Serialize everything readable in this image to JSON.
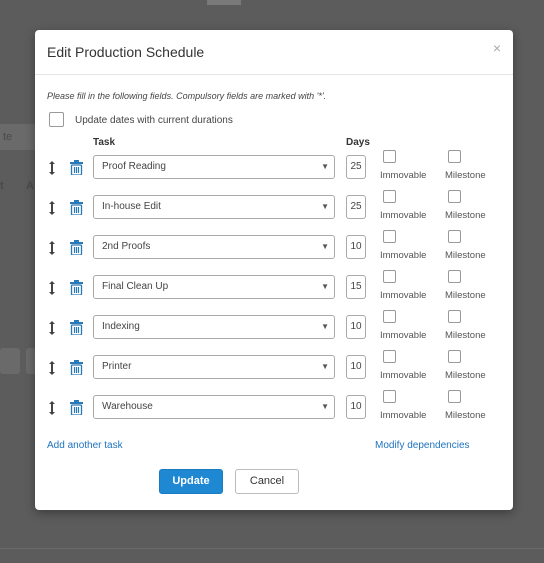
{
  "background": {
    "fragments": [
      "te",
      "t",
      "A"
    ]
  },
  "modal": {
    "title": "Edit Production Schedule",
    "close_icon": "×",
    "instructions": "Please fill in the following fields. Compulsory fields are marked with '*'.",
    "update_dates_label": "Update dates with current durations",
    "headers": {
      "task": "Task",
      "days": "Days"
    },
    "rows": [
      {
        "task": "Proof Reading",
        "days": "25",
        "immovable": "Immovable",
        "milestone": "Milestone"
      },
      {
        "task": "In-house Edit",
        "days": "25",
        "immovable": "Immovable",
        "milestone": "Milestone"
      },
      {
        "task": "2nd Proofs",
        "days": "10",
        "immovable": "Immovable",
        "milestone": "Milestone"
      },
      {
        "task": "Final Clean Up",
        "days": "15",
        "immovable": "Immovable",
        "milestone": "Milestone"
      },
      {
        "task": "Indexing",
        "days": "10",
        "immovable": "Immovable",
        "milestone": "Milestone"
      },
      {
        "task": "Printer",
        "days": "10",
        "immovable": "Immovable",
        "milestone": "Milestone"
      },
      {
        "task": "Warehouse",
        "days": "10",
        "immovable": "Immovable",
        "milestone": "Milestone"
      }
    ],
    "add_task_link": "Add another task",
    "modify_dependencies_link": "Modify dependencies",
    "update_button": "Update",
    "cancel_button": "Cancel"
  },
  "colors": {
    "accent": "#1e88d2",
    "link": "#1e73be",
    "icon": "#2a7ab8"
  }
}
